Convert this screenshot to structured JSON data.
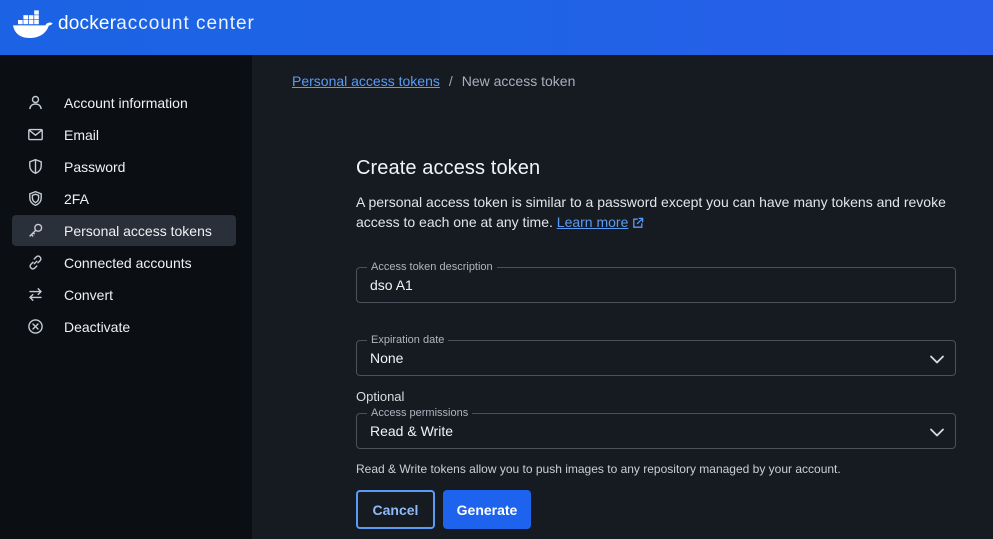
{
  "header": {
    "brand": "docker",
    "subtitle": "account center",
    "logo_icon": "docker-whale-icon",
    "colors": {
      "bar": "#1d63ed",
      "logo": "#ffffff"
    }
  },
  "sidebar": {
    "items": [
      {
        "label": "Account information",
        "icon": "user-icon",
        "active": false
      },
      {
        "label": "Email",
        "icon": "mail-icon",
        "active": false
      },
      {
        "label": "Password",
        "icon": "shield-icon",
        "active": false
      },
      {
        "label": "2FA",
        "icon": "double-shield-icon",
        "active": false
      },
      {
        "label": "Personal access tokens",
        "icon": "key-icon",
        "active": true
      },
      {
        "label": "Connected accounts",
        "icon": "link-icon",
        "active": false
      },
      {
        "label": "Convert",
        "icon": "swap-arrows-icon",
        "active": false
      },
      {
        "label": "Deactivate",
        "icon": "circle-x-icon",
        "active": false
      }
    ]
  },
  "breadcrumb": {
    "parent": "Personal access tokens",
    "separator": "/",
    "current": "New access token"
  },
  "form": {
    "title": "Create access token",
    "description": "A personal access token is similar to a password except you can have many tokens and revoke access to each one at any time.",
    "learn_more": "Learn more",
    "description_field": {
      "label": "Access token description",
      "value": "dso A1"
    },
    "expiration": {
      "label": "Expiration date",
      "value": "None"
    },
    "optional_label": "Optional",
    "permissions": {
      "label": "Access permissions",
      "value": "Read & Write"
    },
    "permissions_hint": "Read & Write tokens allow you to push images to any repository managed by your account.",
    "cancel_label": "Cancel",
    "generate_label": "Generate"
  },
  "colors": {
    "accent": "#1d63ed",
    "link": "#5b9bf6",
    "sidebar_bg": "#0b0e12",
    "main_bg": "#161b22",
    "active_item_bg": "#2a3039"
  }
}
